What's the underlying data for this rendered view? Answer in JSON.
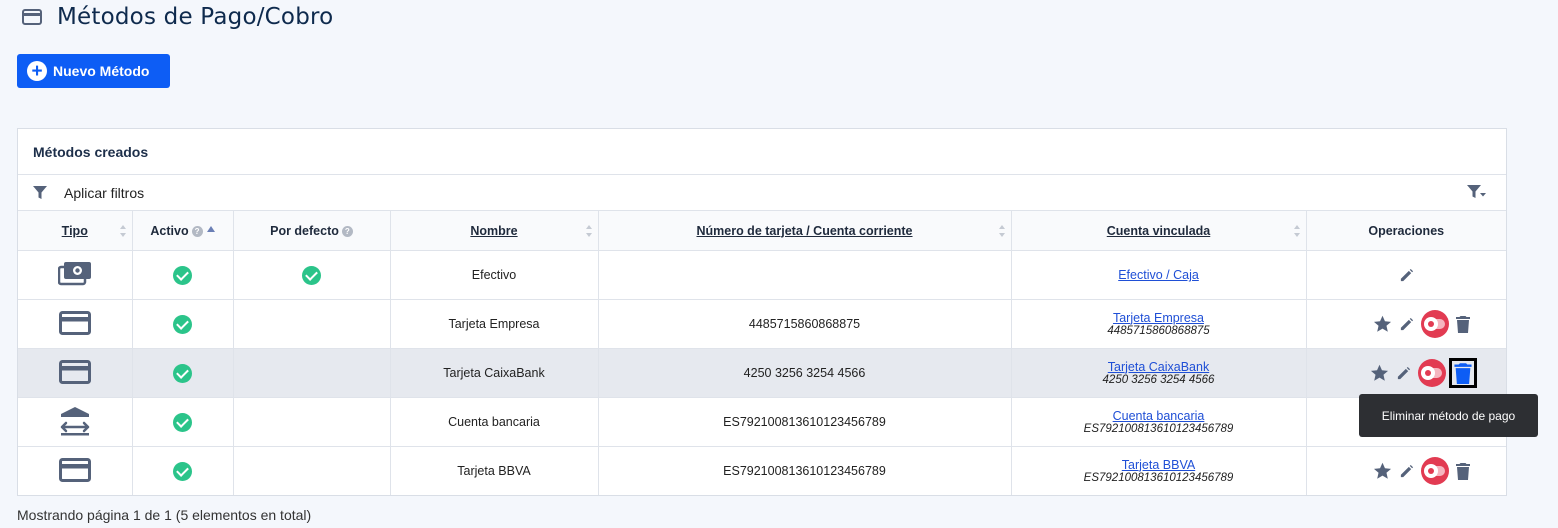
{
  "page": {
    "title": "Métodos de Pago/Cobro"
  },
  "actions": {
    "new_method_label": "Nuevo Método"
  },
  "panel": {
    "title": "Métodos creados",
    "filter_label": "Aplicar filtros"
  },
  "table": {
    "columns": {
      "tipo": "Tipo",
      "activo": "Activo",
      "por_defecto": "Por defecto",
      "nombre": "Nombre",
      "numero": "Número de tarjeta / Cuenta corriente",
      "cuenta": "Cuenta vinculada",
      "operaciones": "Operaciones"
    },
    "rows": [
      {
        "type_icon": "cash-icon",
        "active": true,
        "default": true,
        "name": "Efectivo",
        "number": "",
        "account_link": "Efectivo / Caja",
        "account_sub": ""
      },
      {
        "type_icon": "card-icon",
        "active": true,
        "default": false,
        "name": "Tarjeta Empresa",
        "number": "4485715860868875",
        "account_link": "Tarjeta Empresa",
        "account_sub": "4485715860868875"
      },
      {
        "type_icon": "card-icon",
        "active": true,
        "default": false,
        "name": "Tarjeta CaixaBank",
        "number": "4250 3256 3254 4566",
        "account_link": "Tarjeta CaixaBank",
        "account_sub": "4250 3256 3254 4566"
      },
      {
        "type_icon": "bank-transfer-icon",
        "active": true,
        "default": false,
        "name": "Cuenta bancaria",
        "number": "ES7921008136101234567​89",
        "account_link": "Cuenta bancaria",
        "account_sub": "ES7921008136101234567​89"
      },
      {
        "type_icon": "card-icon",
        "active": true,
        "default": false,
        "name": "Tarjeta BBVA",
        "number": "ES7921008136101234567​89",
        "account_link": "Tarjeta BBVA",
        "account_sub": "ES7921008136101234567​89"
      }
    ]
  },
  "tooltip": {
    "text": "Eliminar método de pago"
  },
  "footer": {
    "text": "Mostrando página 1 de 1 (5 elementos en total)"
  },
  "colors": {
    "primary": "#0d5df5",
    "active": "#2bc48a",
    "toggle": "#e23b52",
    "link": "#1f4fd6"
  }
}
